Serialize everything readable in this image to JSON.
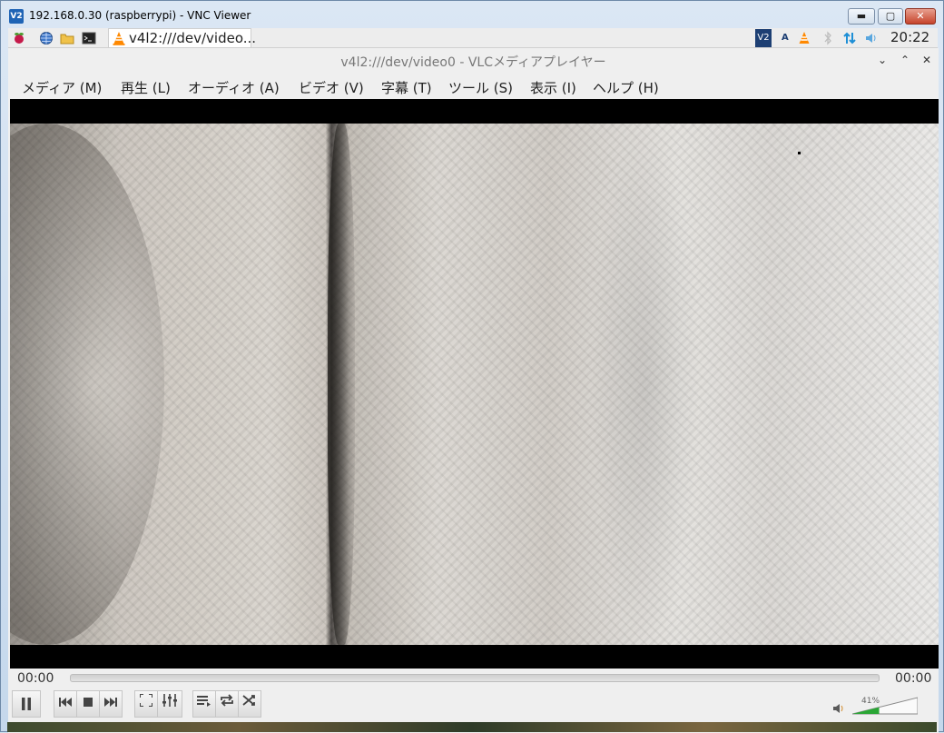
{
  "window": {
    "title": "192.168.0.30 (raspberrypi) - VNC Viewer",
    "app_icon_text": "V2",
    "controls": {
      "minimize": "▬",
      "maximize": "▢",
      "close": "✕"
    }
  },
  "panel": {
    "task_label": "v4l2:///dev/video...",
    "clock": "20:22",
    "tray_vnc_icon_text": "V2",
    "tray_a_text": "A"
  },
  "vlc": {
    "title": "v4l2:///dev/video0 - VLCメディアプレイヤー",
    "title_controls": {
      "minimize": "⌄",
      "maximize": "⌃",
      "close": "✕"
    },
    "menu": [
      "メディア (M)",
      "再生 (L)",
      "オーディオ (A)",
      "ビデオ (V)",
      "字幕 (T)",
      "ツール (S)",
      "表示 (I)",
      "ヘルプ (H)"
    ],
    "elapsed": "00:00",
    "remaining": "00:00",
    "volume_label": "41%",
    "volume_level": 0.41,
    "colors": {
      "accent": "#ff8800",
      "volume_fill": "#2aa635"
    }
  }
}
